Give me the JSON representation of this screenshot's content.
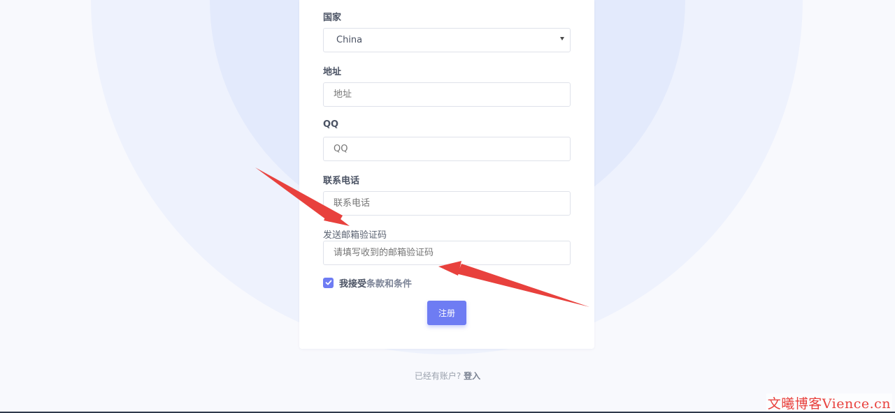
{
  "form": {
    "country_label": "国家",
    "country_value": "China",
    "address_label": "地址",
    "address_placeholder": "地址",
    "qq_label": "QQ",
    "qq_placeholder": "QQ",
    "phone_label": "联系电话",
    "phone_placeholder": "联系电话",
    "email_code_label": "发送邮箱验证码",
    "email_code_placeholder": "请填写收到的邮箱验证码",
    "accept_text": "我接受",
    "terms_link": "条款和条件",
    "accept_checked": true,
    "submit_label": "注册"
  },
  "footer": {
    "have_account_text": "已经有账户?",
    "login_link": "登入"
  },
  "watermark": "文曦博客Vience.cn",
  "colors": {
    "accent": "#6e7cf3",
    "arrow": "#e8413d",
    "background": "#f8f9fd",
    "circle_outer": "#eef2fd",
    "circle_inner": "#e3eafc"
  },
  "icons": {
    "select_caret": "chevron-down-icon",
    "checkbox": "check-icon"
  }
}
